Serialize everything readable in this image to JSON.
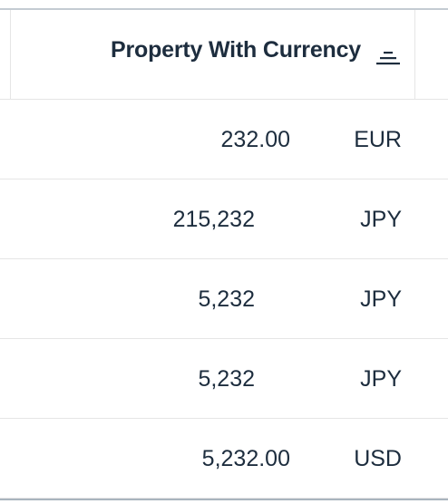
{
  "column": {
    "header_label": "Property With Currency",
    "sort_icon": "sort-descending-icon"
  },
  "rows": [
    {
      "amount": "232.00",
      "currency": "EUR",
      "has_decimals": true
    },
    {
      "amount": "215,232",
      "currency": "JPY",
      "has_decimals": false
    },
    {
      "amount": "5,232",
      "currency": "JPY",
      "has_decimals": false
    },
    {
      "amount": "5,232",
      "currency": "JPY",
      "has_decimals": false
    },
    {
      "amount": "5,232.00",
      "currency": "USD",
      "has_decimals": true
    }
  ],
  "colors": {
    "text": "#1d2d3e",
    "border": "#e5e5e5"
  }
}
